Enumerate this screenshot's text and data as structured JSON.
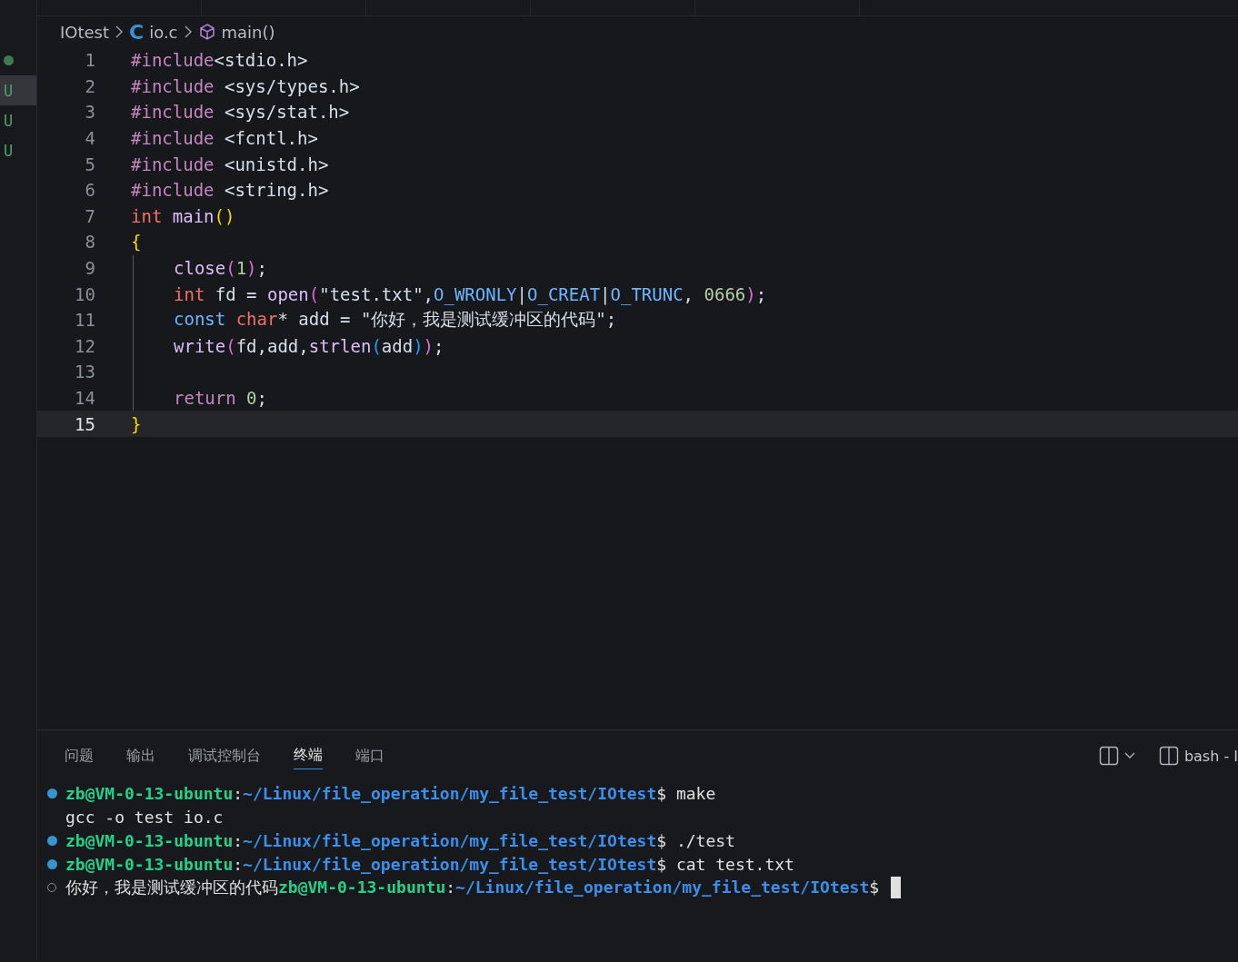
{
  "side_marks": [
    {
      "kind": "dot",
      "selected": false
    },
    {
      "kind": "letter",
      "text": "U",
      "selected": true
    },
    {
      "kind": "letter",
      "text": "U",
      "selected": false
    },
    {
      "kind": "letter",
      "text": "U",
      "selected": false
    }
  ],
  "breadcrumb": [
    {
      "kind": "folder",
      "text": "IOtest"
    },
    {
      "kind": "file",
      "icon": "C",
      "text": "io.c"
    },
    {
      "kind": "symbol",
      "text": "main()"
    }
  ],
  "code_lines": [
    {
      "number": "1",
      "active": false,
      "tokens": [
        {
          "kind": "pre",
          "t": "#include"
        },
        {
          "kind": "inc",
          "t": "<stdio.h>"
        }
      ]
    },
    {
      "number": "2",
      "active": false,
      "tokens": [
        {
          "kind": "pre",
          "t": "#include"
        },
        {
          "kind": "inc",
          "t": " <sys/types.h>"
        }
      ]
    },
    {
      "number": "3",
      "active": false,
      "tokens": [
        {
          "kind": "pre",
          "t": "#include"
        },
        {
          "kind": "inc",
          "t": " <sys/stat.h>"
        }
      ]
    },
    {
      "number": "4",
      "active": false,
      "tokens": [
        {
          "kind": "pre",
          "t": "#include"
        },
        {
          "kind": "inc",
          "t": " <fcntl.h>"
        }
      ]
    },
    {
      "number": "5",
      "active": false,
      "tokens": [
        {
          "kind": "pre",
          "t": "#include"
        },
        {
          "kind": "inc",
          "t": " <unistd.h>"
        }
      ]
    },
    {
      "number": "6",
      "active": false,
      "tokens": [
        {
          "kind": "pre",
          "t": "#include"
        },
        {
          "kind": "inc",
          "t": " <string.h>"
        }
      ]
    },
    {
      "number": "7",
      "active": false,
      "tokens": [
        {
          "kind": "kw",
          "t": "int"
        },
        {
          "kind": "fn",
          "t": " main"
        },
        {
          "kind": "b1",
          "t": "()"
        }
      ]
    },
    {
      "number": "8",
      "active": false,
      "tokens": [
        {
          "kind": "b1",
          "t": "{"
        }
      ]
    },
    {
      "number": "9",
      "active": false,
      "indent": true,
      "tokens": [
        {
          "kind": "fn",
          "t": "close"
        },
        {
          "kind": "b2",
          "t": "("
        },
        {
          "kind": "num",
          "t": "1"
        },
        {
          "kind": "b2",
          "t": ")"
        },
        {
          "kind": "plain",
          "t": ";"
        }
      ]
    },
    {
      "number": "10",
      "active": false,
      "indent": true,
      "tokens": [
        {
          "kind": "kw",
          "t": "int"
        },
        {
          "kind": "plain",
          "t": " fd = "
        },
        {
          "kind": "fn",
          "t": "open"
        },
        {
          "kind": "b2",
          "t": "("
        },
        {
          "kind": "str",
          "t": "\"test.txt\""
        },
        {
          "kind": "plain",
          "t": ","
        },
        {
          "kind": "const",
          "t": "O_WRONLY"
        },
        {
          "kind": "plain",
          "t": "|"
        },
        {
          "kind": "const",
          "t": "O_CREAT"
        },
        {
          "kind": "plain",
          "t": "|"
        },
        {
          "kind": "const",
          "t": "O_TRUNC"
        },
        {
          "kind": "plain",
          "t": ","
        },
        {
          "kind": "num",
          "t": " 0666"
        },
        {
          "kind": "b2",
          "t": ")"
        },
        {
          "kind": "plain",
          "t": ";"
        }
      ]
    },
    {
      "number": "11",
      "active": false,
      "indent": true,
      "tokens": [
        {
          "kind": "storage",
          "t": "const"
        },
        {
          "kind": "kw",
          "t": " char"
        },
        {
          "kind": "plain",
          "t": "* add = "
        },
        {
          "kind": "str",
          "t": "\"你好，我是测试缓冲区的代码\""
        },
        {
          "kind": "plain",
          "t": ";"
        }
      ]
    },
    {
      "number": "12",
      "active": false,
      "indent": true,
      "tokens": [
        {
          "kind": "fn",
          "t": "write"
        },
        {
          "kind": "b2",
          "t": "("
        },
        {
          "kind": "plain",
          "t": "fd,add,"
        },
        {
          "kind": "fn",
          "t": "strlen"
        },
        {
          "kind": "b3",
          "t": "("
        },
        {
          "kind": "plain",
          "t": "add"
        },
        {
          "kind": "b3",
          "t": ")"
        },
        {
          "kind": "b2",
          "t": ")"
        },
        {
          "kind": "plain",
          "t": ";"
        }
      ]
    },
    {
      "number": "13",
      "active": false,
      "indent": true
    },
    {
      "number": "14",
      "active": false,
      "indent": true,
      "tokens": [
        {
          "kind": "pre",
          "t": "return"
        },
        {
          "kind": "num",
          "t": " 0"
        },
        {
          "kind": "plain",
          "t": ";"
        }
      ]
    },
    {
      "number": "15",
      "active": true,
      "tokens": [
        {
          "kind": "b1",
          "t": "}"
        }
      ]
    }
  ],
  "panel_tabs": [
    {
      "label": "问题",
      "selected": false
    },
    {
      "label": "输出",
      "selected": false
    },
    {
      "label": "调试控制台",
      "selected": false
    },
    {
      "label": "终端",
      "selected": true
    },
    {
      "label": "端口",
      "selected": false
    }
  ],
  "terminal_instance": "bash - I",
  "terminal_lines": [
    {
      "kind": "success",
      "parts": [
        {
          "kind": "user",
          "t": "zb@VM-0-13-ubuntu"
        },
        {
          "kind": "plain",
          "t": ":"
        },
        {
          "kind": "path",
          "t": "~/Linux/file_operation/my_file_test/IOtest"
        },
        {
          "kind": "plain",
          "t": "$ make"
        }
      ]
    },
    {
      "kind": "output",
      "parts": [
        {
          "kind": "plain",
          "t": "gcc -o test io.c"
        }
      ]
    },
    {
      "kind": "success",
      "parts": [
        {
          "kind": "user",
          "t": "zb@VM-0-13-ubuntu"
        },
        {
          "kind": "plain",
          "t": ":"
        },
        {
          "kind": "path",
          "t": "~/Linux/file_operation/my_file_test/IOtest"
        },
        {
          "kind": "plain",
          "t": "$ ./test"
        }
      ]
    },
    {
      "kind": "success",
      "parts": [
        {
          "kind": "user",
          "t": "zb@VM-0-13-ubuntu"
        },
        {
          "kind": "plain",
          "t": ":"
        },
        {
          "kind": "path",
          "t": "~/Linux/file_operation/my_file_test/IOtest"
        },
        {
          "kind": "plain",
          "t": "$ cat test.txt"
        }
      ]
    },
    {
      "kind": "pending",
      "cursor": true,
      "parts": [
        {
          "kind": "plain",
          "t": "你好，我是测试缓冲区的代码"
        },
        {
          "kind": "user",
          "t": "zb@VM-0-13-ubuntu"
        },
        {
          "kind": "plain",
          "t": ":"
        },
        {
          "kind": "path",
          "t": "~/Linux/file_operation/my_file_test/IOtest"
        },
        {
          "kind": "plain",
          "t": "$"
        }
      ]
    }
  ]
}
